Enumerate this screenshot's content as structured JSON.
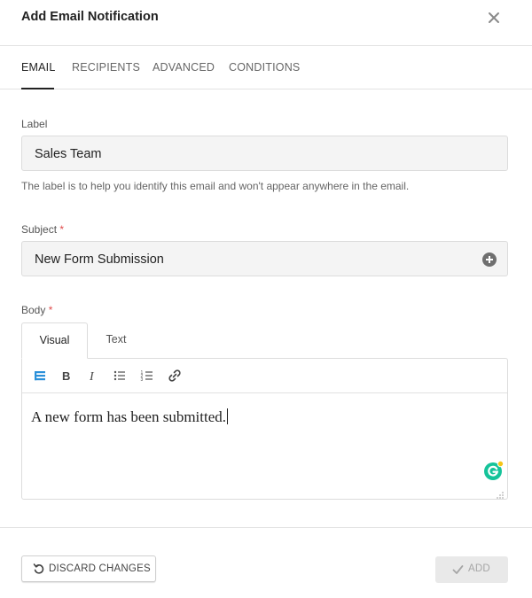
{
  "dialog": {
    "title": "Add Email Notification",
    "close_icon": "close-icon"
  },
  "tabs": [
    {
      "label": "EMAIL",
      "active": true
    },
    {
      "label": "RECIPIENTS",
      "active": false
    },
    {
      "label": "ADVANCED",
      "active": false
    },
    {
      "label": "CONDITIONS",
      "active": false
    }
  ],
  "label_field": {
    "label": "Label",
    "value": "Sales Team",
    "help": "The label is to help you identify this email and won't appear anywhere in the email."
  },
  "subject_field": {
    "label": "Subject",
    "required_mark": "*",
    "value": "New Form Submission",
    "insert_icon": "plus-circle-icon"
  },
  "body_field": {
    "label": "Body",
    "required_mark": "*",
    "editor_tabs": [
      "Visual",
      "Text"
    ],
    "active_editor_tab": "Visual",
    "toolbar_icons": [
      "toolbar-toggle-icon",
      "bold-icon",
      "italic-icon",
      "bullet-list-icon",
      "numbered-list-icon",
      "link-icon"
    ],
    "content": "A new form has been submitted."
  },
  "footer": {
    "discard_label": "DISCARD CHANGES",
    "add_label": "ADD",
    "add_enabled": false
  },
  "colors": {
    "accent": "#2b90d9",
    "required": "#e04b4b",
    "grammarly": "#15c39a"
  }
}
